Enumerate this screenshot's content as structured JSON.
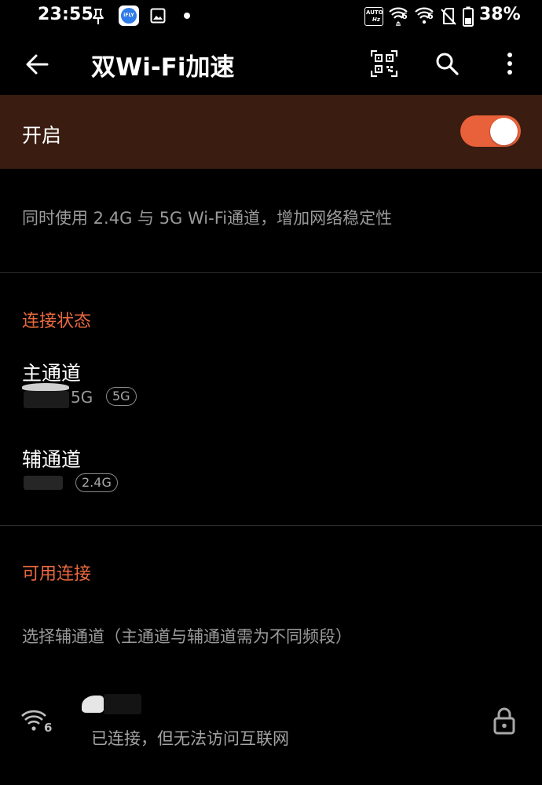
{
  "status_bar": {
    "time": "23:55",
    "battery_percent": "38%",
    "indicators": [
      "pin-icon",
      "ifly-app-icon",
      "image-icon",
      "dot-icon",
      "auto-hz-icon",
      "wifi-6-icon",
      "wifi-6-icon",
      "no-sim-icon",
      "battery-icon"
    ],
    "ifly_label": "iFLY",
    "auto_label": "AUTO",
    "hz_label": "Hz",
    "wifi_gen": "6"
  },
  "app_bar": {
    "title": "双Wi-Fi加速",
    "actions": [
      "qr-scan-icon",
      "search-icon",
      "more-vert-icon"
    ],
    "back_icon": "arrow-back-icon"
  },
  "master_switch": {
    "label": "开启",
    "on": true
  },
  "description": "同时使用 2.4G 与 5G Wi-Fi通道，增加网络稳定性",
  "connection_status": {
    "header": "连接状态",
    "primary": {
      "title": "主通道",
      "ssid_suffix": "5G",
      "band_badge": "5G"
    },
    "secondary": {
      "title": "辅通道",
      "band_badge": "2.4G"
    }
  },
  "available": {
    "header": "可用连接",
    "hint": "选择辅通道（主通道与辅通道需为不同频段）",
    "networks": [
      {
        "status": "已连接，但无法访问互联网",
        "wifi_gen": "6",
        "icons": [
          "wifi-6-icon",
          "lock-icon"
        ]
      }
    ]
  },
  "colors": {
    "accent": "#e8613a",
    "section_header": "#e8693f",
    "switch_row_bg": "#3a1c10",
    "background": "#000000",
    "secondary_text": "#9a9a9a"
  }
}
